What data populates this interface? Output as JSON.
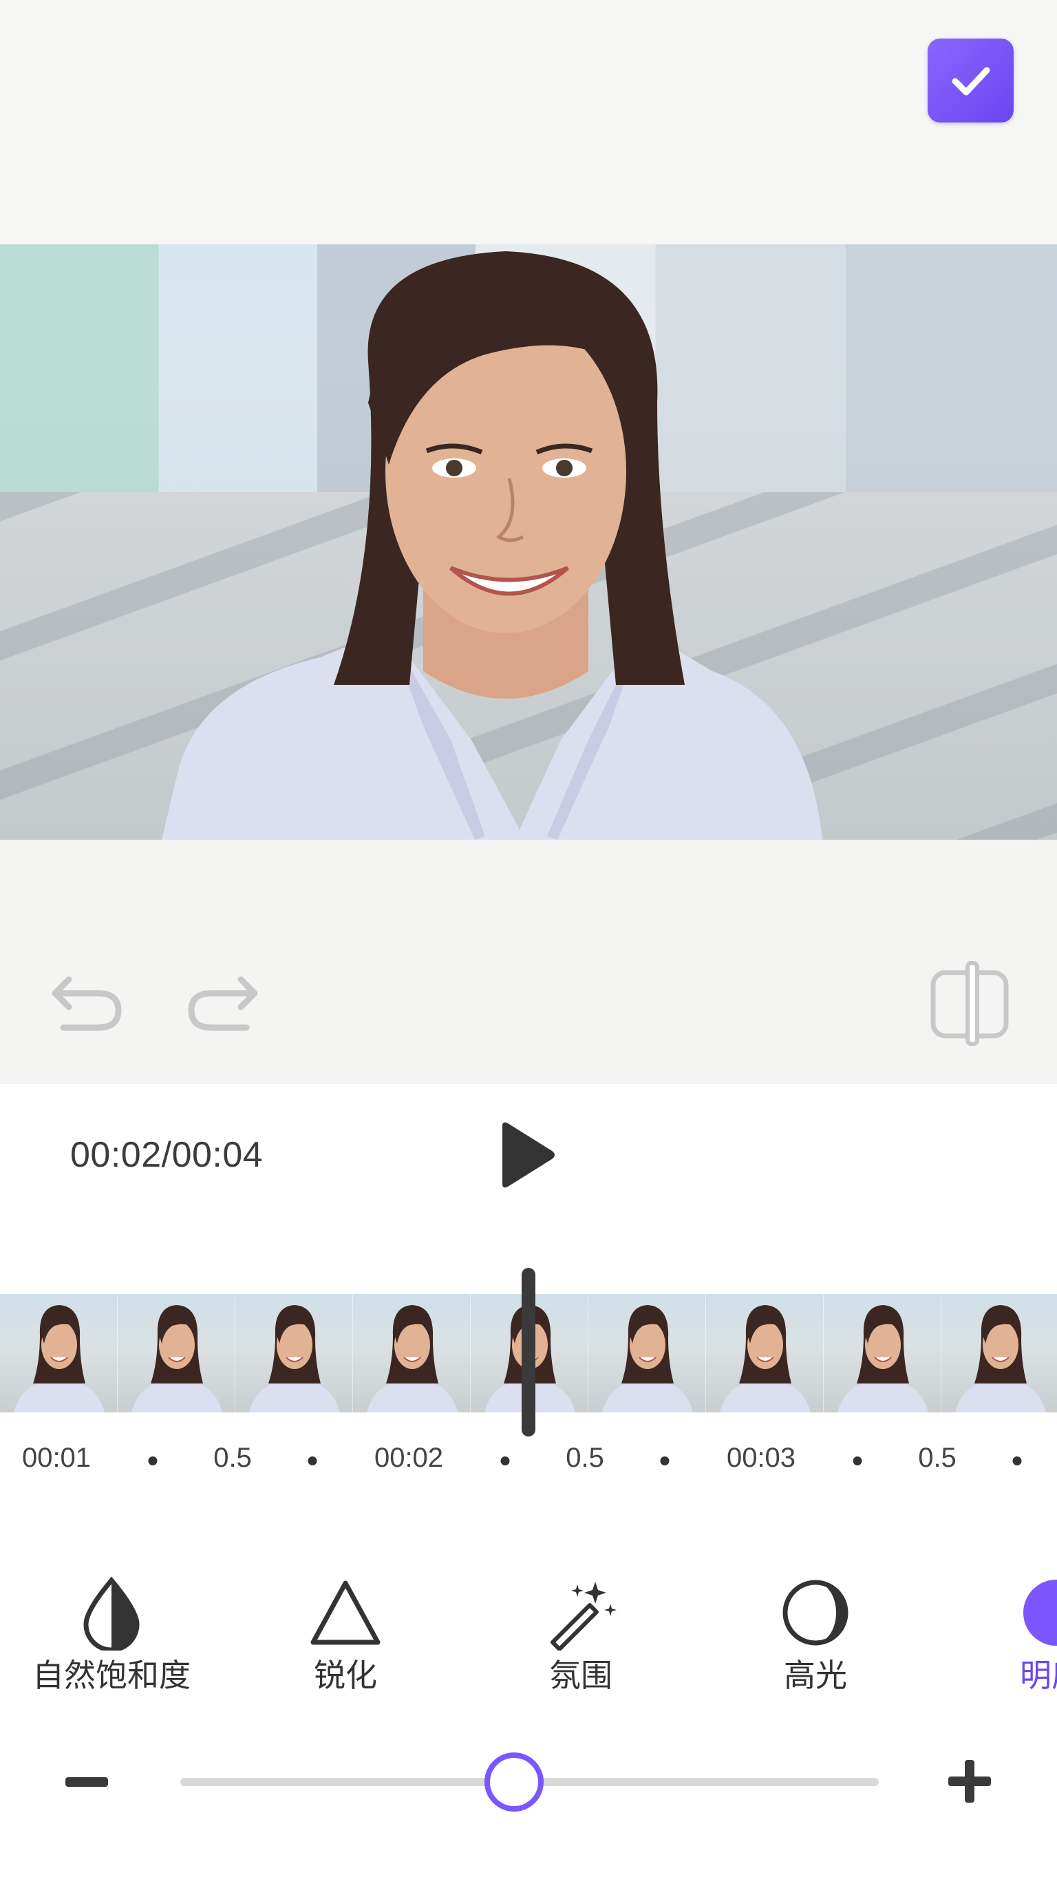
{
  "header": {
    "confirm_icon": "checkmark-icon",
    "accent_color": "#6a45f0"
  },
  "editor": {
    "undo_icon": "undo-icon",
    "redo_icon": "redo-icon",
    "compare_icon": "compare-icon"
  },
  "playback": {
    "time": "00:02/00:04",
    "play_icon": "play-icon"
  },
  "timeline": {
    "ruler": [
      "00:01",
      "0.5",
      "00:02",
      "0.5",
      "00:03",
      "0.5"
    ]
  },
  "tools": [
    {
      "label": "自然饱和度",
      "icon": "droplet-icon"
    },
    {
      "label": "锐化",
      "icon": "triangle-icon"
    },
    {
      "label": "氛围",
      "icon": "magic-wand-icon"
    },
    {
      "label": "高光",
      "icon": "crescent-icon"
    },
    {
      "label": "明度",
      "icon": "brightness-icon",
      "active": true
    }
  ],
  "adjust_slider": {
    "value_fraction": 0.48,
    "minus_icon": "minus-icon",
    "plus_icon": "plus-icon"
  }
}
